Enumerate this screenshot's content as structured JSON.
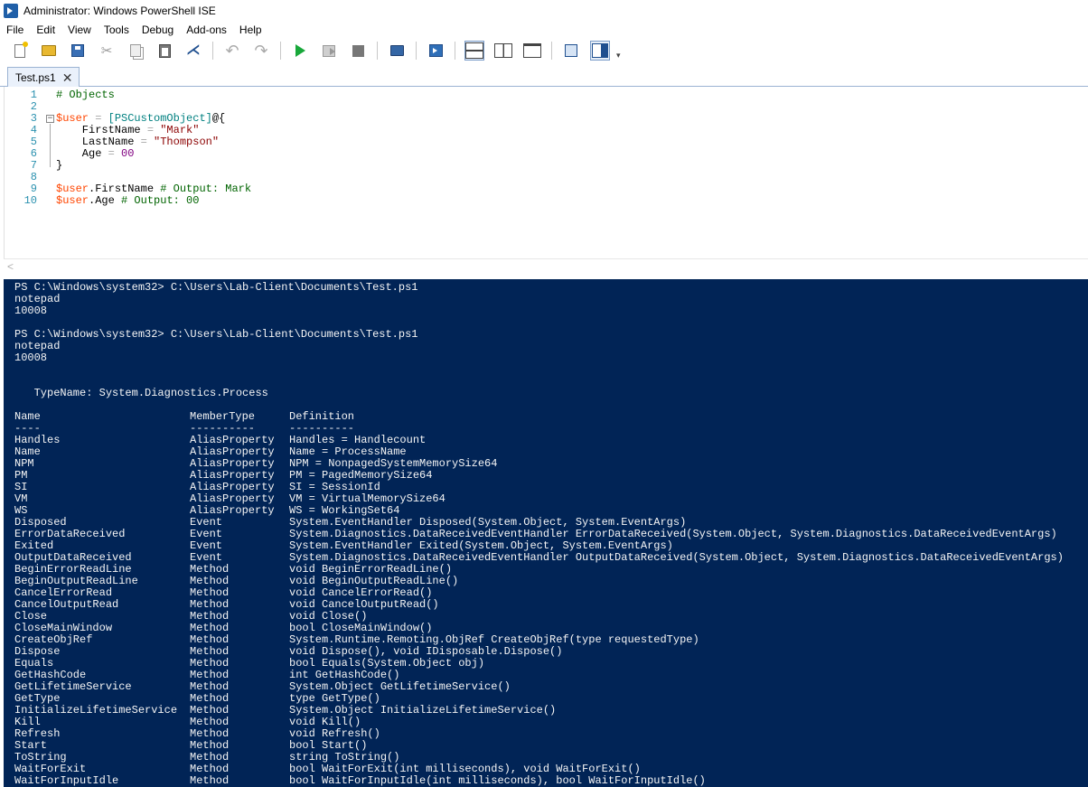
{
  "window": {
    "title": "Administrator: Windows PowerShell ISE"
  },
  "menu": [
    "File",
    "Edit",
    "View",
    "Tools",
    "Debug",
    "Add-ons",
    "Help"
  ],
  "toolbar": {
    "icons": [
      "new-file-icon",
      "open-file-icon",
      "save-icon",
      "cut-icon",
      "copy-icon",
      "paste-icon",
      "clear-console-icon",
      "undo-icon",
      "redo-icon",
      "run-script-icon",
      "run-selection-icon",
      "stop-icon",
      "remote-tab-icon",
      "start-powershell-icon",
      "show-script-top-icon",
      "show-script-right-icon",
      "show-script-maximized-icon",
      "show-commands-icon",
      "show-addon-icon"
    ]
  },
  "tab": {
    "label": "Test.ps1",
    "close": "✕"
  },
  "editor": {
    "lines": [
      {
        "n": "1",
        "tokens": [
          {
            "t": "# Objects",
            "k": "comment"
          }
        ]
      },
      {
        "n": "2",
        "tokens": []
      },
      {
        "n": "3",
        "tokens": [
          {
            "t": "$user",
            "k": "var"
          },
          {
            "t": " ",
            "k": "plain"
          },
          {
            "t": "=",
            "k": "op"
          },
          {
            "t": " ",
            "k": "plain"
          },
          {
            "t": "[PSCustomObject]",
            "k": "type"
          },
          {
            "t": "@{",
            "k": "plain"
          }
        ]
      },
      {
        "n": "4",
        "tokens": [
          {
            "t": "    FirstName ",
            "k": "plain"
          },
          {
            "t": "=",
            "k": "op"
          },
          {
            "t": " ",
            "k": "plain"
          },
          {
            "t": "\"Mark\"",
            "k": "str"
          }
        ]
      },
      {
        "n": "5",
        "tokens": [
          {
            "t": "    LastName ",
            "k": "plain"
          },
          {
            "t": "=",
            "k": "op"
          },
          {
            "t": " ",
            "k": "plain"
          },
          {
            "t": "\"Thompson\"",
            "k": "str"
          }
        ]
      },
      {
        "n": "6",
        "tokens": [
          {
            "t": "    Age ",
            "k": "plain"
          },
          {
            "t": "=",
            "k": "op"
          },
          {
            "t": " ",
            "k": "plain"
          },
          {
            "t": "00",
            "k": "num"
          }
        ]
      },
      {
        "n": "7",
        "tokens": [
          {
            "t": "}",
            "k": "plain"
          }
        ]
      },
      {
        "n": "8",
        "tokens": []
      },
      {
        "n": "9",
        "tokens": [
          {
            "t": "$user",
            "k": "var"
          },
          {
            "t": ".FirstName",
            "k": "member"
          },
          {
            "t": " ",
            "k": "plain"
          },
          {
            "t": "# Output: Mark",
            "k": "comment"
          }
        ]
      },
      {
        "n": "10",
        "tokens": [
          {
            "t": "$user",
            "k": "var"
          },
          {
            "t": ".Age",
            "k": "member"
          },
          {
            "t": " ",
            "k": "plain"
          },
          {
            "t": "# Output: 00",
            "k": "comment"
          }
        ]
      }
    ]
  },
  "console": {
    "lines": [
      "PS C:\\Windows\\system32> C:\\Users\\Lab-Client\\Documents\\Test.ps1",
      "notepad",
      "10008",
      "",
      "PS C:\\Windows\\system32> C:\\Users\\Lab-Client\\Documents\\Test.ps1",
      "notepad",
      "10008",
      "",
      "",
      "   TypeName: System.Diagnostics.Process",
      ""
    ],
    "table": {
      "headers": [
        "Name",
        "MemberType",
        "Definition"
      ],
      "underlines": [
        "----",
        "----------",
        "----------"
      ],
      "rows": [
        [
          "Handles",
          "AliasProperty",
          "Handles = Handlecount"
        ],
        [
          "Name",
          "AliasProperty",
          "Name = ProcessName"
        ],
        [
          "NPM",
          "AliasProperty",
          "NPM = NonpagedSystemMemorySize64"
        ],
        [
          "PM",
          "AliasProperty",
          "PM = PagedMemorySize64"
        ],
        [
          "SI",
          "AliasProperty",
          "SI = SessionId"
        ],
        [
          "VM",
          "AliasProperty",
          "VM = VirtualMemorySize64"
        ],
        [
          "WS",
          "AliasProperty",
          "WS = WorkingSet64"
        ],
        [
          "Disposed",
          "Event",
          "System.EventHandler Disposed(System.Object, System.EventArgs)"
        ],
        [
          "ErrorDataReceived",
          "Event",
          "System.Diagnostics.DataReceivedEventHandler ErrorDataReceived(System.Object, System.Diagnostics.DataReceivedEventArgs)"
        ],
        [
          "Exited",
          "Event",
          "System.EventHandler Exited(System.Object, System.EventArgs)"
        ],
        [
          "OutputDataReceived",
          "Event",
          "System.Diagnostics.DataReceivedEventHandler OutputDataReceived(System.Object, System.Diagnostics.DataReceivedEventArgs)"
        ],
        [
          "BeginErrorReadLine",
          "Method",
          "void BeginErrorReadLine()"
        ],
        [
          "BeginOutputReadLine",
          "Method",
          "void BeginOutputReadLine()"
        ],
        [
          "CancelErrorRead",
          "Method",
          "void CancelErrorRead()"
        ],
        [
          "CancelOutputRead",
          "Method",
          "void CancelOutputRead()"
        ],
        [
          "Close",
          "Method",
          "void Close()"
        ],
        [
          "CloseMainWindow",
          "Method",
          "bool CloseMainWindow()"
        ],
        [
          "CreateObjRef",
          "Method",
          "System.Runtime.Remoting.ObjRef CreateObjRef(type requestedType)"
        ],
        [
          "Dispose",
          "Method",
          "void Dispose(), void IDisposable.Dispose()"
        ],
        [
          "Equals",
          "Method",
          "bool Equals(System.Object obj)"
        ],
        [
          "GetHashCode",
          "Method",
          "int GetHashCode()"
        ],
        [
          "GetLifetimeService",
          "Method",
          "System.Object GetLifetimeService()"
        ],
        [
          "GetType",
          "Method",
          "type GetType()"
        ],
        [
          "InitializeLifetimeService",
          "Method",
          "System.Object InitializeLifetimeService()"
        ],
        [
          "Kill",
          "Method",
          "void Kill()"
        ],
        [
          "Refresh",
          "Method",
          "void Refresh()"
        ],
        [
          "Start",
          "Method",
          "bool Start()"
        ],
        [
          "ToString",
          "Method",
          "string ToString()"
        ],
        [
          "WaitForExit",
          "Method",
          "bool WaitForExit(int milliseconds), void WaitForExit()"
        ],
        [
          "WaitForInputIdle",
          "Method",
          "bool WaitForInputIdle(int milliseconds), bool WaitForInputIdle()"
        ]
      ]
    }
  },
  "colors": {
    "console_bg": "#012456",
    "console_fg": "#f5f5f5",
    "comment": "#006400",
    "variable": "#ff4500",
    "type": "#008080",
    "string": "#8b0000",
    "number": "#800080",
    "line_number": "#2b91af"
  }
}
